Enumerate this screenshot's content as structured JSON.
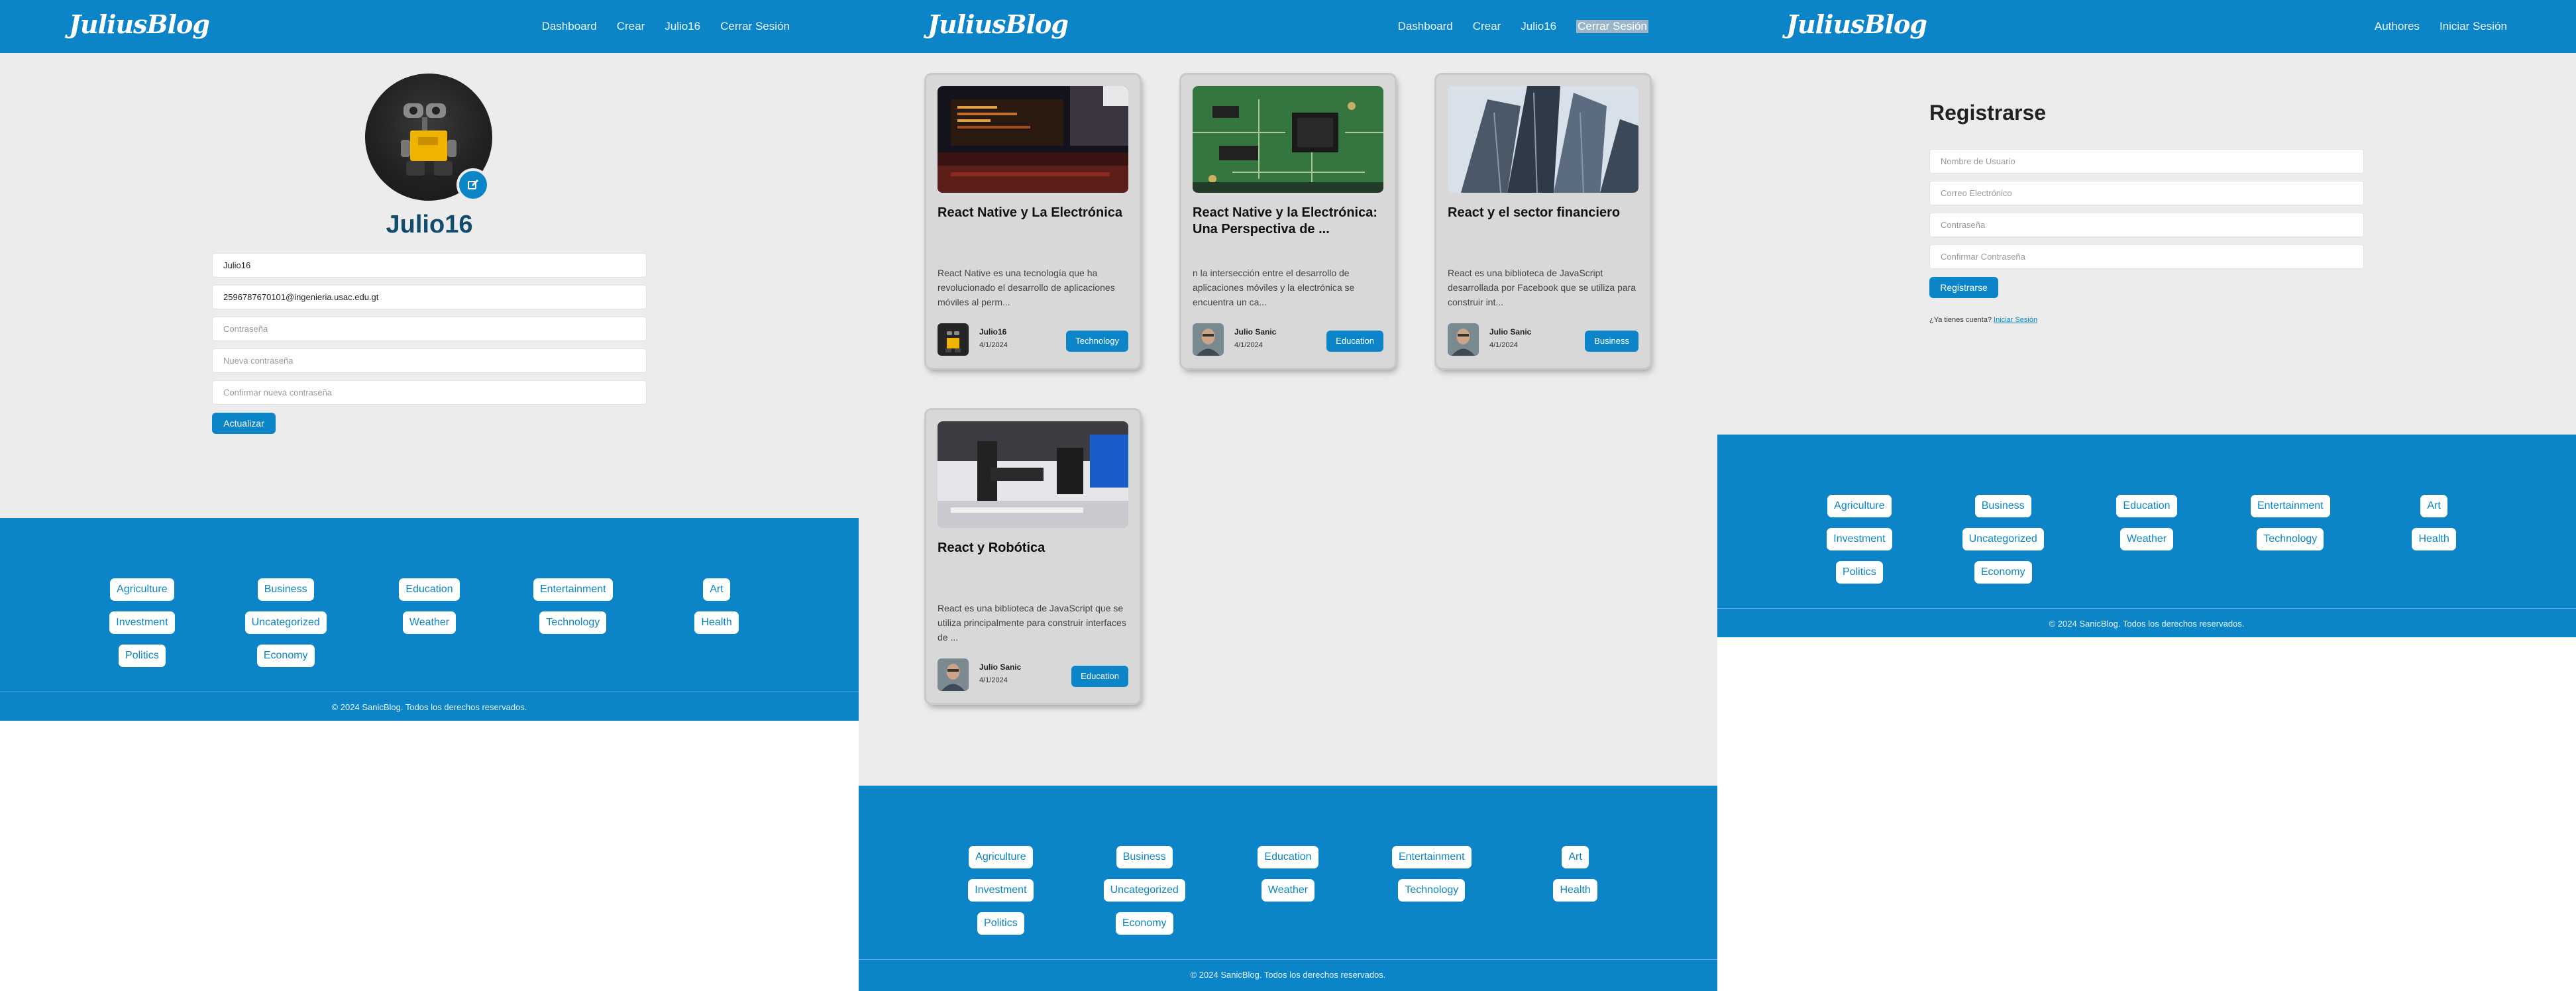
{
  "brand": {
    "logo": "JuliusBlog",
    "accent": "#0c84c8",
    "background": "#ececec"
  },
  "panel1": {
    "nav": [
      "Dashboard",
      "Crear",
      "Julio16",
      "Cerrar Sesión"
    ],
    "profile": {
      "username": "Julio16",
      "avatar": "robot-avatar",
      "edit_icon": "edit-icon",
      "name_value": "Julio16",
      "email_value": "2596787670101@ingenieria.usac.edu.gt",
      "password_placeholder": "Contraseña",
      "new_password_placeholder": "Nueva contraseña",
      "confirm_password_placeholder": "Confirmar nueva contraseña",
      "update_button": "Actualizar"
    }
  },
  "panel2": {
    "nav": [
      "Dashboard",
      "Crear",
      "Julio16",
      "Cerrar Sesión"
    ],
    "cards": [
      {
        "title": "React Native y La Electrónica",
        "excerpt": "React Native es una tecnología que ha revolucionado el desarrollo de aplicaciones móviles al perm...",
        "author": "Julio16",
        "date": "4/1/2024",
        "category": "Technology",
        "image": "computer-screen-image"
      },
      {
        "title": "React Native y la Electrónica: Una Perspectiva de ...",
        "excerpt": "n la intersección entre el desarrollo de aplicaciones móviles y la electrónica se encuentra un ca...",
        "author": "Julio Sanic",
        "date": "4/1/2024",
        "category": "Education",
        "image": "circuit-board-image"
      },
      {
        "title": "React y el sector financiero",
        "excerpt": "React es una biblioteca de JavaScript desarrollada por Facebook que se utiliza para construir int...",
        "author": "Julio Sanic",
        "date": "4/1/2024",
        "category": "Business",
        "image": "skyscrapers-image"
      },
      {
        "title": "React y Robótica",
        "excerpt": "React es una biblioteca de JavaScript que se utiliza principalmente para construir interfaces de ...",
        "author": "Julio Sanic",
        "date": "4/1/2024",
        "category": "Education",
        "image": "robot-arm-image"
      }
    ]
  },
  "panel3": {
    "nav": [
      "Authores",
      "Iniciar Sesión"
    ],
    "register": {
      "title": "Registrarse",
      "username_placeholder": "Nombre de Usuario",
      "email_placeholder": "Correo Electrónico",
      "password_placeholder": "Contraseña",
      "confirm_placeholder": "Confirmar Contraseña",
      "button": "Registrarse",
      "have_account": "¿Ya tienes cuenta?",
      "login_link": "Iniciar Sesión"
    }
  },
  "footer": {
    "categories": [
      "Agriculture",
      "Business",
      "Education",
      "Entertainment",
      "Art",
      "Investment",
      "Uncategorized",
      "Weather",
      "Technology",
      "Health",
      "Politics",
      "Economy"
    ],
    "copyright": "© 2024 SanicBlog. Todos los derechos reservados."
  }
}
